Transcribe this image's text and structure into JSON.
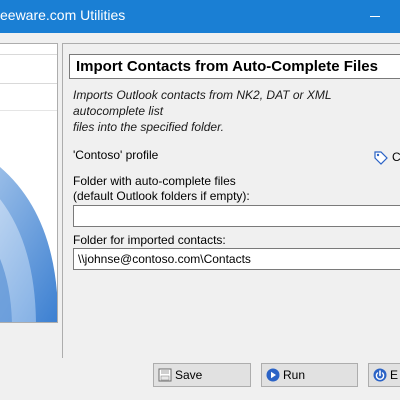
{
  "window": {
    "title": "eeware.com Utilities"
  },
  "panel": {
    "header_title": "Import Contacts from Auto-Complete Files",
    "description": "Imports Outlook contacts from NK2, DAT or XML autocomplete list\nfiles into the specified folder.",
    "profile_label": "'Contoso' profile",
    "profile_link": "Co",
    "autocomplete_label": "Folder with auto-complete files\n(default Outlook folders if empty):",
    "autocomplete_value": "",
    "dest_label": "Folder for imported contacts:",
    "dest_value": "\\\\johnse@contoso.com\\Contacts"
  },
  "buttons": {
    "save": "Save",
    "run": "Run",
    "exit": "E"
  },
  "colors": {
    "titlebar": "#1a7fd4",
    "window_bg": "#f0f0f0",
    "accent_blue": "#2b63c6"
  },
  "icons": {
    "minimize": "minimize-icon",
    "profile": "tag-icon",
    "save": "save-icon",
    "run": "run-icon",
    "exit": "exit-icon"
  }
}
